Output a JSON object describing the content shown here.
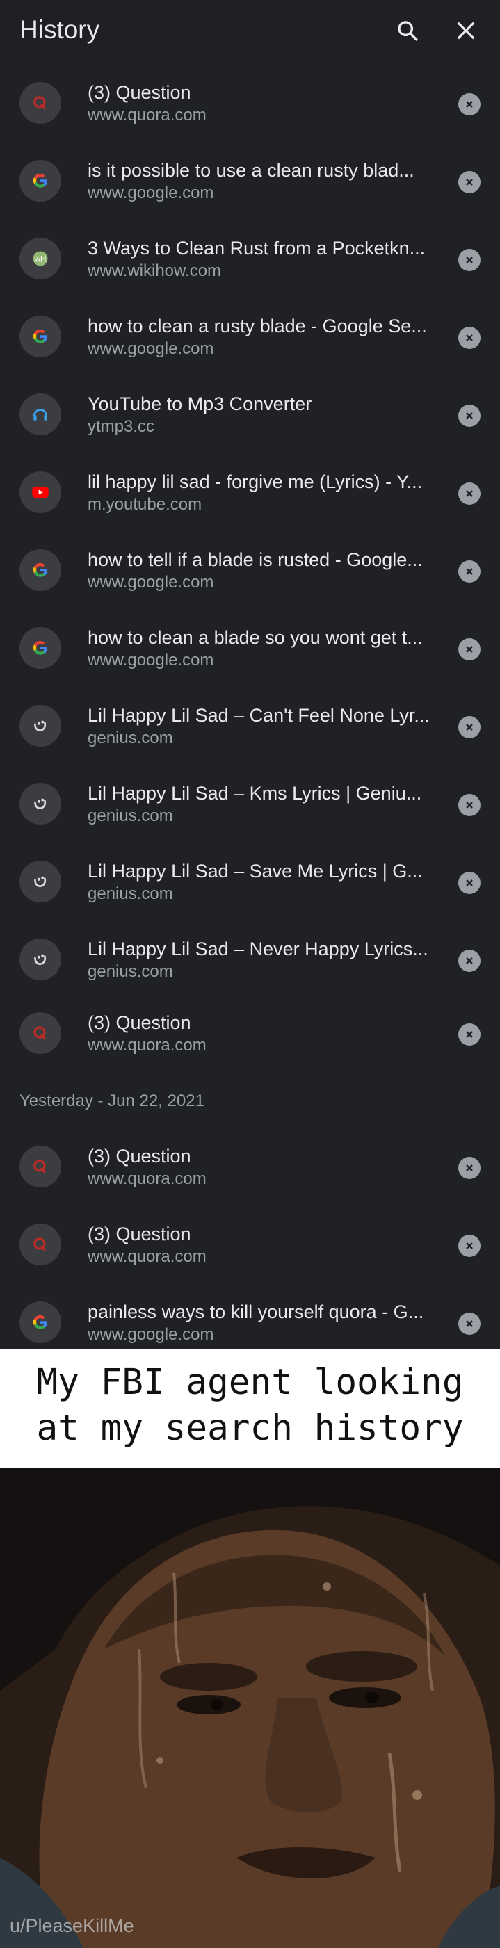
{
  "header": {
    "title": "History",
    "search_icon": "search-icon",
    "close_icon": "close-icon"
  },
  "history_today": [
    {
      "title": "(3) Question",
      "url": "www.quora.com",
      "favicon": "quora-icon"
    },
    {
      "title": "is it possible to use a clean rusty blad...",
      "url": "www.google.com",
      "favicon": "google-icon"
    },
    {
      "title": "3 Ways to Clean Rust from a Pocketkn...",
      "url": "www.wikihow.com",
      "favicon": "wikihow-icon"
    },
    {
      "title": "how to clean a rusty blade - Google Se...",
      "url": "www.google.com",
      "favicon": "google-icon"
    },
    {
      "title": "YouTube to Mp3 Converter",
      "url": "ytmp3.cc",
      "favicon": "ytmp3-icon"
    },
    {
      "title": "lil happy lil sad - forgive me (Lyrics) - Y...",
      "url": "m.youtube.com",
      "favicon": "youtube-icon"
    },
    {
      "title": "how to tell if a blade is rusted - Google...",
      "url": "www.google.com",
      "favicon": "google-icon"
    },
    {
      "title": "how to clean a blade so you wont get t...",
      "url": "www.google.com",
      "favicon": "google-icon"
    },
    {
      "title": "Lil Happy Lil Sad – Can't Feel None Lyr...",
      "url": "genius.com",
      "favicon": "genius-icon"
    },
    {
      "title": "Lil Happy Lil Sad – Kms Lyrics | Geniu...",
      "url": "genius.com",
      "favicon": "genius-icon"
    },
    {
      "title": "Lil Happy Lil Sad – Save Me Lyrics | G...",
      "url": "genius.com",
      "favicon": "genius-icon"
    },
    {
      "title": "Lil Happy Lil Sad – Never Happy Lyrics...",
      "url": "genius.com",
      "favicon": "genius-icon"
    },
    {
      "title": "(3) Question",
      "url": "www.quora.com",
      "favicon": "quora-icon"
    }
  ],
  "section_yesterday": "Yesterday - Jun 22, 2021",
  "history_yesterday": [
    {
      "title": "(3) Question",
      "url": "www.quora.com",
      "favicon": "quora-icon"
    },
    {
      "title": "(3) Question",
      "url": "www.quora.com",
      "favicon": "quora-icon"
    },
    {
      "title": "painless ways to kill yourself quora - G...",
      "url": "www.google.com",
      "favicon": "google-icon"
    }
  ],
  "meme": {
    "caption_line1": "My FBI agent looking",
    "caption_line2": "at my search history",
    "watermark": "u/PleaseKillMe"
  },
  "colors": {
    "background": "#202124",
    "text": "#e8eaed",
    "secondary": "#9aa0a6"
  }
}
